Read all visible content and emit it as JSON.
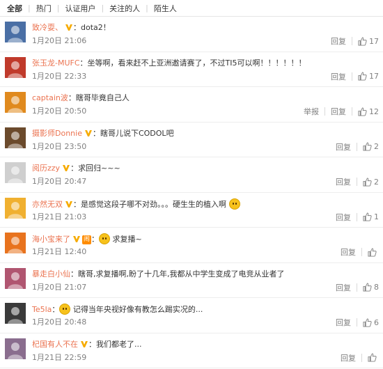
{
  "tabs": [
    "全部",
    "热门",
    "认证用户",
    "关注的人",
    "陌生人"
  ],
  "actions": {
    "reply": "回复",
    "report": "举报"
  },
  "comments": [
    {
      "user": "致冷耍、",
      "badge": "V",
      "text": "dota2！",
      "time": "1月20日 21:06",
      "likes": "17",
      "avatar_color": "#4a6fa5"
    },
    {
      "user": "张玉龙-MUFC",
      "badge": "",
      "text": "坐等啊，看来赶不上亚洲邀请赛了，不过TI5可以啊！！！！！！",
      "time": "1月20日 22:33",
      "likes": "17",
      "avatar_color": "#c03a2b"
    },
    {
      "user": "captain波",
      "badge": "",
      "text": "瞎哥毕竟自己人",
      "time": "1月20日 20:50",
      "likes": "12",
      "report": true,
      "avatar_color": "#e08a1e"
    },
    {
      "user": "摄影师Donnie",
      "badge": "V",
      "text": "瞎哥儿说下CODOL吧",
      "time": "1月20日 23:50",
      "likes": "2",
      "avatar_color": "#6b4a2c"
    },
    {
      "user": "阅历zzy",
      "badge": "V",
      "text": "求回归~~~",
      "time": "1月20日 20:47",
      "likes": "2",
      "avatar_color": "#cfcfcf"
    },
    {
      "user": "亦然无双",
      "badge": "V",
      "text": "是感觉这段子哪不对劲。。。硬生生的植入啊",
      "time": "1月21日 21:03",
      "likes": "1",
      "emoji_end": true,
      "avatar_color": "#f0b030"
    },
    {
      "user": "海小宝来了",
      "badge": "V",
      "tag": "闹",
      "text": "求复播~",
      "time": "1月21日 12:40",
      "likes": "",
      "emoji_start": true,
      "avatar_color": "#e8731e"
    },
    {
      "user": "暴走白小仙",
      "badge": "",
      "text": "瞎哥,求复播啊,盼了十几年,我都从中学生变成了电竞从业者了",
      "time": "1月20日 21:07",
      "likes": "8",
      "avatar_color": "#b05570"
    },
    {
      "user": "Te5la",
      "badge": "",
      "text": "记得当年央视好像有教怎么踢实况的...",
      "time": "1月20日 20:48",
      "likes": "6",
      "emoji_start": true,
      "avatar_color": "#3a3a3a"
    },
    {
      "user": "杞国有人不在",
      "badge": "V",
      "text": "我们都老了...",
      "time": "1月21日 22:59",
      "likes": "",
      "avatar_color": "#8a6d8e"
    }
  ]
}
